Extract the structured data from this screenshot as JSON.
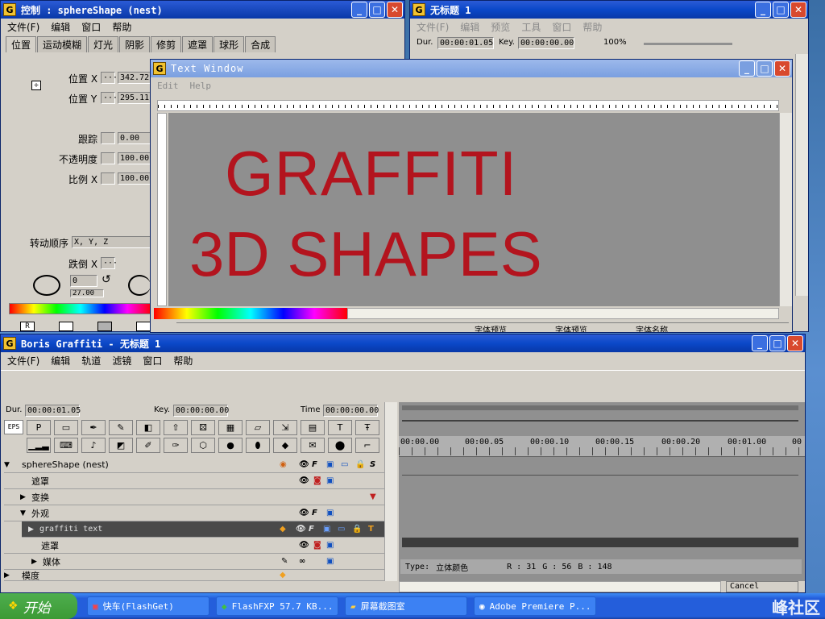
{
  "control_window": {
    "title": "控制 : sphereShape (nest)",
    "menu": [
      "文件(F)",
      "编辑",
      "窗口",
      "帮助"
    ],
    "tabs": [
      "位置",
      "运动模糊",
      "灯光",
      "阴影",
      "修剪",
      "遮罩",
      "球形",
      "合成"
    ],
    "fields": {
      "pos_x_label": "位置 X",
      "pos_x": "342.72",
      "pos_y_label": "位置 Y",
      "pos_y": "295.11",
      "track_label": "跟踪",
      "track": "0.00",
      "opacity_label": "不透明度",
      "opacity": "100.00",
      "scale_label": "比例 X",
      "scale": "100.00",
      "rot_order_label": "转动顺序",
      "rot_order": "X, Y, Z",
      "tumble_label": "跌倒 X",
      "tumble_val": "0",
      "angle": "27.00"
    },
    "bottom_buttons": [
      "R"
    ]
  },
  "untitled_window": {
    "title": "无标题 1",
    "menu": [
      "文件(F)",
      "编辑",
      "预览",
      "工具",
      "窗口",
      "帮助"
    ],
    "dur_label": "Dur.",
    "dur": "00:00:01.05",
    "key_label": "Key.",
    "key": "00:00:00.00",
    "zoom": "100%"
  },
  "text_window": {
    "title": "Text Window",
    "menu": [
      "Edit",
      "Help"
    ],
    "line1": "GRAFFITI",
    "line2": "3D SHAPES",
    "status": [
      "字体预览",
      "字体预览",
      "字体名称"
    ]
  },
  "graffiti_window": {
    "title": "Boris Graffiti - 无标题 1",
    "menu": [
      "文件(F)",
      "编辑",
      "轨道",
      "滤镜",
      "窗口",
      "帮助"
    ],
    "dur_label": "Dur.",
    "dur": "00:00:01.05",
    "key_label": "Key.",
    "key": "00:00:00.00",
    "time_label": "Time",
    "time": "00:00:00.00",
    "eps": "EPS",
    "timecodes": [
      "00:00.00",
      "00:00.05",
      "00:00.10",
      "00:00.15",
      "00:00.20",
      "00:01.00",
      "00"
    ],
    "tracks": [
      {
        "label": "sphereShape (nest)",
        "indent": 0,
        "expander": "▼"
      },
      {
        "label": "遮罩",
        "indent": 1,
        "expander": ""
      },
      {
        "label": "变换",
        "indent": 1,
        "expander": "▶"
      },
      {
        "label": "外观",
        "indent": 1,
        "expander": "▼"
      },
      {
        "label": "graffiti text",
        "indent": 2,
        "expander": "▶"
      },
      {
        "label": "遮罩",
        "indent": 2,
        "expander": ""
      },
      {
        "label": "媒体",
        "indent": 2,
        "expander": "▶"
      },
      {
        "label": "模度",
        "indent": 0,
        "expander": "▶"
      }
    ],
    "color_info": {
      "type_label": "Type:",
      "type": "立体颜色",
      "r": "R : 31",
      "g": "G : 56",
      "b": "B : 148"
    },
    "cancel": "Cancel"
  },
  "taskbar": {
    "start": "开始",
    "items": [
      "快车(FlashGet)",
      "FlashFXP 57.7 KB...",
      "屏幕截图室",
      "Adobe Premiere P..."
    ],
    "watermark": "峰社区"
  },
  "colors": {
    "title_active": "#0a48c8",
    "text_red": "#b3141e",
    "canvas_gray": "#8f8f8f",
    "start_green": "#3c9a35"
  }
}
